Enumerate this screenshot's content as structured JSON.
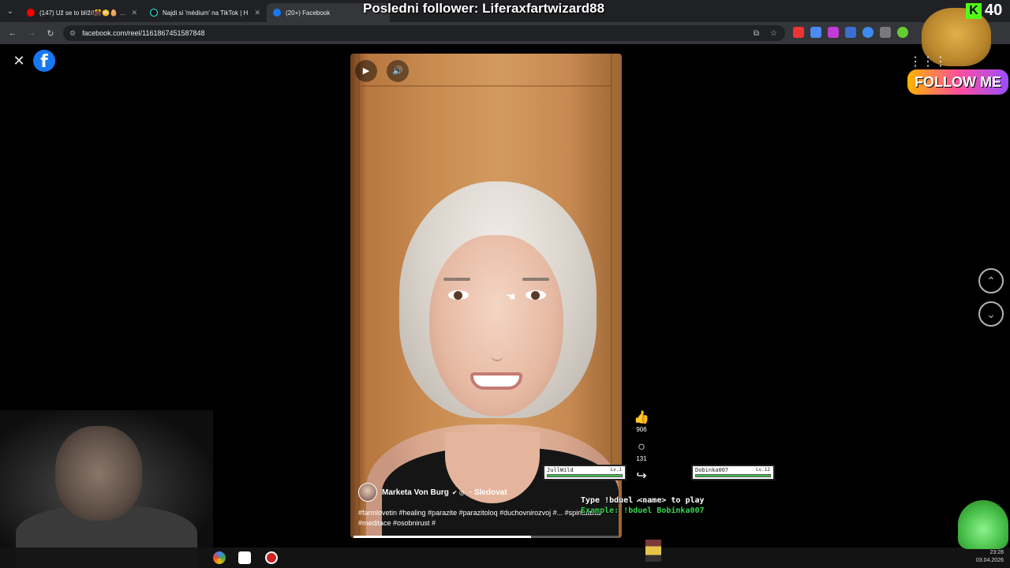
{
  "browser": {
    "tabs": [
      {
        "title": "(147) Už se to blíží!🎊😳🥚 #co",
        "color": "#ff0000",
        "active": false
      },
      {
        "title": "Najdi si 'médium' na TikTok | H",
        "color": "#000000",
        "active": false
      },
      {
        "title": "(20+) Facebook",
        "color": "#1877f2",
        "active": true
      }
    ],
    "url": "facebook.com/reel/1161867451587848"
  },
  "stream_overlay": {
    "last_follower": "Posledni follower: Liferaxfartwizard88",
    "kick_count": "40",
    "follow_me": "FOLLOW ME",
    "duel_line1": "Type !bduel <name> to play",
    "duel_line2": "Example: !bduel Bobinka007",
    "players": [
      {
        "name": "JullWild",
        "level": "Lv.1",
        "hp": 1.0
      },
      {
        "name": "Dobinka007",
        "level": "Lv.12",
        "hp": 1.0
      }
    ]
  },
  "reel": {
    "author": "Marketa Von Burg",
    "follow_label": "· Sledovat",
    "caption": "#farmlovetin #healing #parazite #parazitoloq #duchovnirozvoj #... #spiritualita #meditace #osobnirust #",
    "progress": 0.67,
    "likes": "906",
    "comments": "131"
  },
  "clock": {
    "time": "23:28",
    "date": "03.04.2026"
  },
  "icons": {
    "close": "close-icon",
    "facebook": "facebook-logo",
    "play": "play-icon",
    "volume": "volume-icon",
    "like": "like-icon",
    "comment": "comment-icon",
    "share": "share-icon",
    "more": "more-icon",
    "up": "chevron-up-icon",
    "down": "chevron-down-icon",
    "grid": "grid-icon"
  }
}
